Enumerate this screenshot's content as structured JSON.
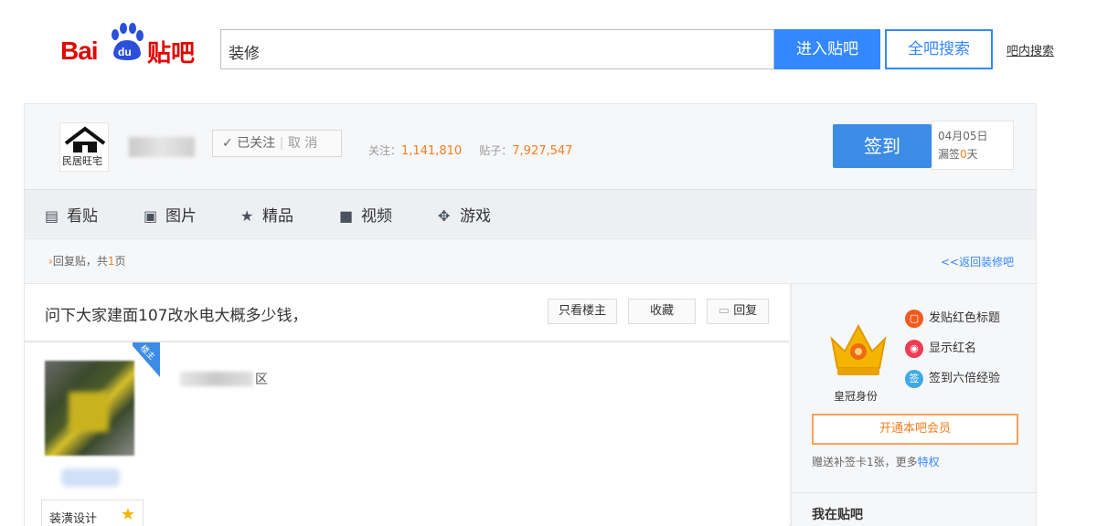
{
  "header": {
    "logo_bai": "Bai",
    "logo_du": "du",
    "logo_tieba": "贴吧",
    "search_value": "装修",
    "enter_button": "进入贴吧",
    "all_search_button": "全吧搜索",
    "in_bar_search": "吧内搜索"
  },
  "forum": {
    "avatar_label": "民居旺宅",
    "followed_label": "已关注",
    "cancel_label": "取 消",
    "follow_stat_label": "关注：",
    "follow_count": "1,141,810",
    "post_stat_label": "贴子：",
    "post_count": "7,927,547",
    "sign_button": "签到",
    "sign_date": "04月05日",
    "sign_streak_prefix": "漏签",
    "sign_streak_value": "0",
    "sign_streak_suffix": "天"
  },
  "tabs": [
    {
      "label": "看贴",
      "icon": "document-icon"
    },
    {
      "label": "图片",
      "icon": "image-icon"
    },
    {
      "label": "精品",
      "icon": "star-icon"
    },
    {
      "label": "视频",
      "icon": "video-icon"
    },
    {
      "label": "游戏",
      "icon": "gamepad-icon"
    }
  ],
  "reply_bar": {
    "prefix": "回复贴，共",
    "pages": "1",
    "suffix": "页",
    "back_link": "<<返回装修吧"
  },
  "post": {
    "title": "问下大家建面107改水电大概多少钱，",
    "only_author_button": "只看楼主",
    "collect_button": "收藏",
    "reply_button": "回复",
    "author_ribbon": "楼主",
    "username_suffix": "区",
    "badge_label": "装潢设计"
  },
  "sidebar": {
    "crown_label": "皇冠身份",
    "perks": [
      "发贴红色标题",
      "显示红名",
      "签到六倍经验"
    ],
    "member_button": "开通本吧会员",
    "gift_text_prefix": "赠送补签卡1张，更多",
    "gift_link": "特权",
    "section_title": "我在贴吧"
  }
}
